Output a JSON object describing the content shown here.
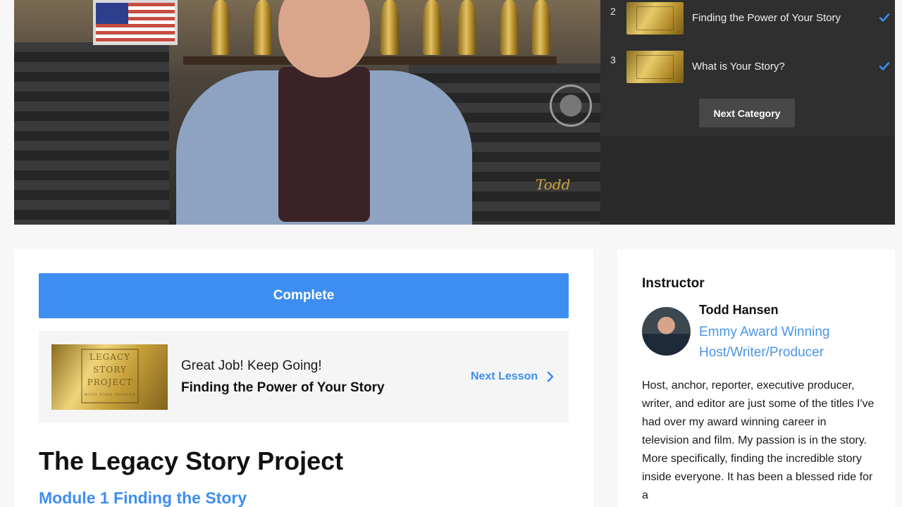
{
  "playlist": {
    "items": [
      {
        "number": "2",
        "title": "Finding the Power of Your Story",
        "completed": true
      },
      {
        "number": "3",
        "title": "What is Your Story?",
        "completed": true
      }
    ],
    "next_category_label": "Next Category"
  },
  "video": {
    "signature_text": "Todd"
  },
  "lesson": {
    "complete_label": "Complete",
    "next": {
      "kicker": "Great Job! Keep Going!",
      "title": "Finding the Power of Your Story",
      "link_label": "Next Lesson",
      "thumb_line1": "LEGACY STORY",
      "thumb_line2": "PROJECT",
      "thumb_line3": "WITH TODD HANSEN"
    },
    "course_title": "The Legacy Story Project",
    "module_title": "Module 1 Finding the Story"
  },
  "instructor": {
    "heading": "Instructor",
    "name": "Todd Hansen",
    "role": "Emmy Award Winning Host/Writer/Producer",
    "bio": "Host, anchor, reporter, executive producer, writer, and editor are just some of the titles I've had over my award winning career in television and film. My passion is in the story. More specifically, finding the incredible story inside everyone. It has been a blessed ride for a"
  },
  "colors": {
    "accent": "#3d8ef0",
    "link": "#4a95e6",
    "playlist_bg": "#2f2f2f",
    "check": "#3d8ef0"
  }
}
